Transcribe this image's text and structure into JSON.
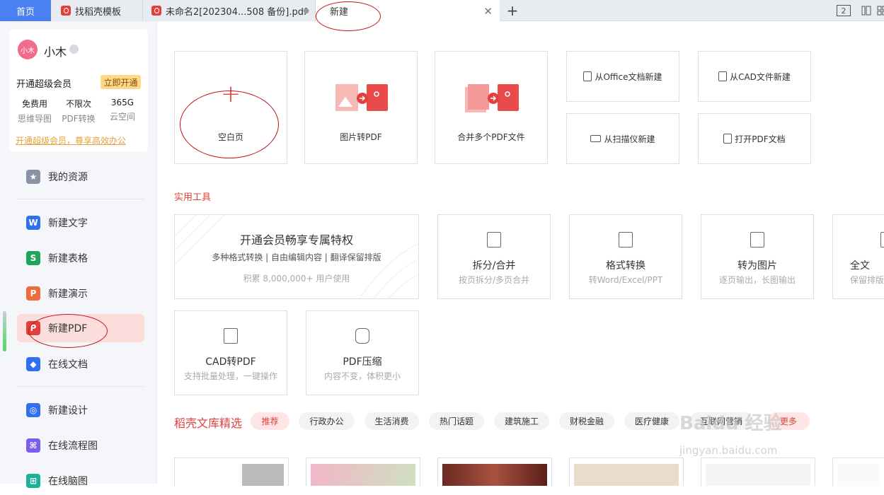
{
  "tabs": {
    "home": "首页",
    "template": "找稻壳模板",
    "doc": "未命名2[202304...508 备份].pdf",
    "active": "新建",
    "new_tab": "+",
    "layout_label": "2"
  },
  "user": {
    "avatar_text": "小木",
    "name": "小木",
    "vip_text": "开通超级会员",
    "vip_button": "立即开通",
    "perks": [
      {
        "value": "免费用",
        "label": "思维导图"
      },
      {
        "value": "不限次",
        "label": "PDF转换"
      },
      {
        "value": "365G",
        "label": "云空间"
      }
    ],
    "vip_link": "开通超级会员，尊享高效办公"
  },
  "nav": [
    {
      "label": "我的资源",
      "icon": "star-icon",
      "color": "#8a93a6"
    },
    {
      "label": "新建文字",
      "icon": "writer-icon",
      "color": "#2f6ff0"
    },
    {
      "label": "新建表格",
      "icon": "sheet-icon",
      "color": "#1ea45c"
    },
    {
      "label": "新建演示",
      "icon": "presentation-icon",
      "color": "#ef6b3a"
    },
    {
      "label": "新建PDF",
      "icon": "pdf-icon",
      "color": "#e2403c"
    },
    {
      "label": "在线文档",
      "icon": "cloud-doc-icon",
      "color": "#2f6ff0"
    },
    {
      "label": "新建设计",
      "icon": "design-icon",
      "color": "#2f6ff0"
    },
    {
      "label": "在线流程图",
      "icon": "flowchart-icon",
      "color": "#7b5cf0"
    },
    {
      "label": "在线脑图",
      "icon": "mindmap-icon",
      "color": "#18b39a"
    }
  ],
  "create": {
    "blank": "空白页",
    "plus": "+",
    "image_to_pdf": "图片转PDF",
    "merge_pdf": "合并多个PDF文件",
    "from_office": "从Office文档新建",
    "from_cad": "从CAD文件新建",
    "from_scanner": "从扫描仪新建",
    "open_pdf": "打开PDF文档"
  },
  "tools_title": "实用工具",
  "promo": {
    "title": "开通会员畅享专属特权",
    "features": "多种格式转换 | 自由编辑内容 | 翻译保留排版",
    "users": "积累 8,000,000+ 用户使用"
  },
  "tools": [
    {
      "name": "拆分/合并",
      "sub": "按页拆分/多页合并",
      "icon": "split-merge-icon"
    },
    {
      "name": "格式转换",
      "sub": "转Word/Excel/PPT",
      "icon": "format-convert-icon"
    },
    {
      "name": "转为图片",
      "sub": "逐页输出，长图输出",
      "icon": "to-image-icon"
    },
    {
      "name": "全文",
      "sub": "保留排版",
      "icon": "translate-icon"
    },
    {
      "name": "CAD转PDF",
      "sub": "支持批量处理，一键操作",
      "icon": "cad-icon"
    },
    {
      "name": "PDF压缩",
      "sub": "内容不变，体积更小",
      "icon": "compress-icon"
    }
  ],
  "library": {
    "title": "稻壳文库精选",
    "chips": [
      "推荐",
      "行政办公",
      "生活消费",
      "热门话题",
      "建筑施工",
      "财税金融",
      "医疗健康",
      "互联网营销",
      "更多"
    ]
  },
  "watermark": {
    "brand": "Baidu 经验",
    "url": "jingyan.baidu.com"
  },
  "colors": {
    "accent": "#e2403c",
    "home_tab": "#4a80f0",
    "vip": "#ffd98a"
  }
}
